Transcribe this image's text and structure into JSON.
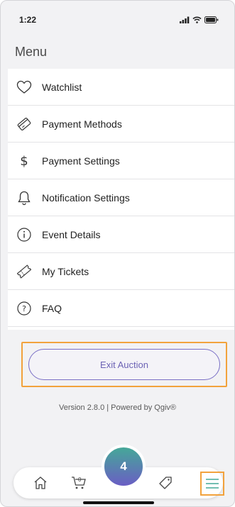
{
  "status_bar": {
    "time": "1:22"
  },
  "menu_title": "Menu",
  "menu_items": [
    {
      "label": "Watchlist",
      "icon": "heart-icon"
    },
    {
      "label": "Payment Methods",
      "icon": "card-icon"
    },
    {
      "label": "Payment Settings",
      "icon": "dollar-icon"
    },
    {
      "label": "Notification Settings",
      "icon": "bell-icon"
    },
    {
      "label": "Event Details",
      "icon": "info-icon"
    },
    {
      "label": "My Tickets",
      "icon": "ticket-icon"
    },
    {
      "label": "FAQ",
      "icon": "question-icon"
    }
  ],
  "exit_button": {
    "label": "Exit Auction"
  },
  "version_text": "Version 2.8.0 | Powered by Qgiv®",
  "tabbar": {
    "cart_count": "0",
    "center_badge": "4",
    "highlight_color": "#f2a23c",
    "accent_color": "#6c63b5"
  }
}
